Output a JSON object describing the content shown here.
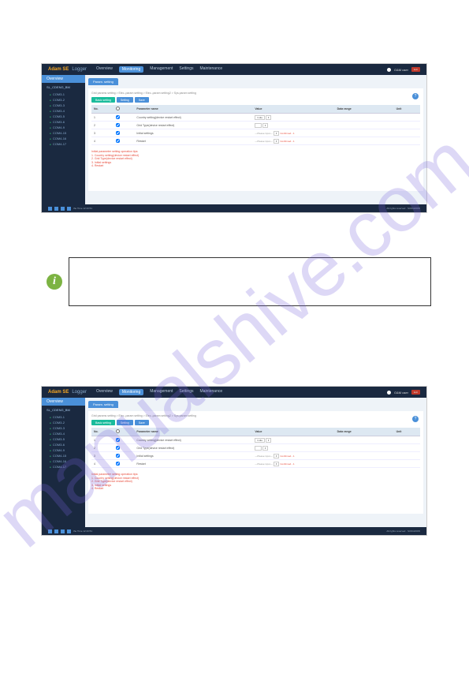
{
  "watermark": "manualshive.com",
  "header": {
    "logo": "Adam SE",
    "brand": "Logger",
    "nav": [
      "Overview",
      "Monitoring",
      "Management",
      "Settings",
      "Maintenance"
    ],
    "user": "O&M user",
    "exit": "Exit"
  },
  "sidebar": {
    "overview": "Overview",
    "group": "SL_CDENG_BM",
    "devices": [
      "COM3-1",
      "COM3-2",
      "COM3-3",
      "COM3-4",
      "COM3-5",
      "COM3-6",
      "COM4-9",
      "COM4-15",
      "COM4-16",
      "COM4-17"
    ]
  },
  "main": {
    "tab": "Param. setting",
    "crumb": "Grid params setting > Elec.-param setting > Elec.-param setting2 > Sys.param setting",
    "buttons": {
      "basic": "Basic setting",
      "setting": "Setting",
      "save": "Save"
    },
    "help": "?",
    "columns": {
      "no": "No.",
      "chk": "",
      "name": "Parameter name",
      "value": "Value",
      "range": "Data range",
      "unit": "Unit"
    },
    "rows": [
      {
        "no": "1",
        "name": "Country setting(device restart effect)",
        "vtype": "sel",
        "value": "India",
        "conf": ""
      },
      {
        "no": "2",
        "name": "Grid Type(device restart effect)",
        "vtype": "sel",
        "value": "",
        "conf": ""
      },
      {
        "no": "3",
        "name": "Initial settings",
        "vtype": "input",
        "value": "—Please input—",
        "conf": "Confirmed - 1"
      },
      {
        "no": "4",
        "name": "Restart",
        "vtype": "input",
        "value": "—Please input—",
        "conf": "Confirmed - 1"
      }
    ],
    "note_title": "Initial parameter setting operation tips:",
    "notes": [
      "1. Country setting(device restart effect)",
      "2. Grid Type(device restart effect)",
      "3. Initial settings",
      "4. Restart"
    ]
  },
  "footer": {
    "time": "the Time 12:43:51",
    "rights": "All rights reserved · SUNGROW"
  }
}
